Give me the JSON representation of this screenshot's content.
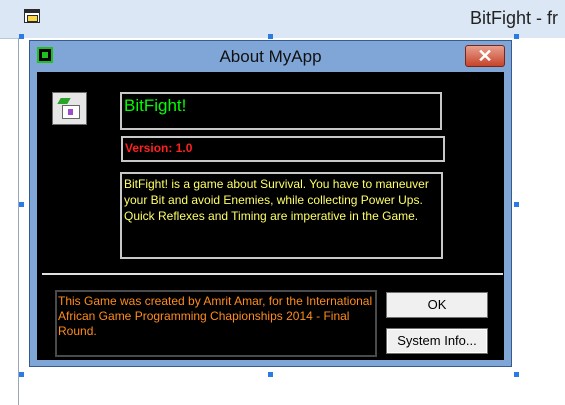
{
  "parent_window": {
    "title": "BitFight - fr",
    "icon": "form-icon"
  },
  "dialog": {
    "title": "About MyApp",
    "icon": "app-icon-green",
    "close_glyph": "✕",
    "app_icon": "application-icon",
    "app_name": "BitFight!",
    "version": "Version: 1.0",
    "description": "BitFight! is a game about Survival. You have to maneuver your Bit and avoid Enemies, while collecting Power Ups. Quick Reflexes and Timing are imperative in the Game.",
    "credits": "This Game was created by Amrit Amar, for the International African Game Programming Chapionships 2014 - Final Round.",
    "ok_label": "OK",
    "system_info_label": "System Info...",
    "colors": {
      "app_name": "#00ff00",
      "version": "#ff2020",
      "description": "#ffff66",
      "credits": "#ff8c1a",
      "background": "#000000"
    }
  }
}
